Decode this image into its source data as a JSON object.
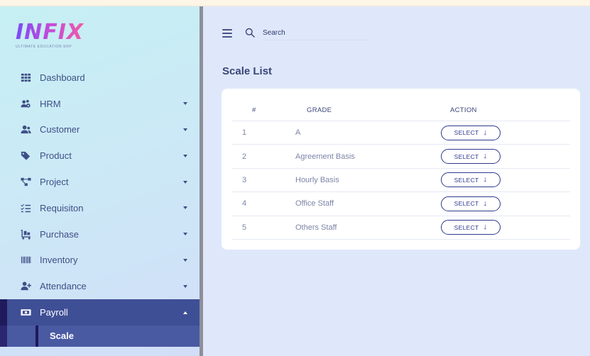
{
  "brand": {
    "name": "INFIX",
    "tagline": "ULTIMATE EDUCATION ERP"
  },
  "sidebar": {
    "items": [
      {
        "label": "Dashboard",
        "icon": "grid-icon",
        "expandable": false
      },
      {
        "label": "HRM",
        "icon": "users-gear-icon",
        "expandable": true
      },
      {
        "label": "Customer",
        "icon": "user-group-icon",
        "expandable": true
      },
      {
        "label": "Product",
        "icon": "tags-icon",
        "expandable": true
      },
      {
        "label": "Project",
        "icon": "project-diagram-icon",
        "expandable": true
      },
      {
        "label": "Requisiton",
        "icon": "checklist-icon",
        "expandable": true
      },
      {
        "label": "Purchase",
        "icon": "cart-flatbed-icon",
        "expandable": true
      },
      {
        "label": "Inventory",
        "icon": "barcode-icon",
        "expandable": true
      },
      {
        "label": "Attendance",
        "icon": "user-plus-icon",
        "expandable": true
      },
      {
        "label": "Payroll",
        "icon": "money-bill-icon",
        "expandable": true,
        "active": true
      }
    ],
    "subitems": [
      {
        "label": "Scale",
        "active": true
      }
    ]
  },
  "header": {
    "search_placeholder": "Search"
  },
  "page": {
    "title": "Scale List"
  },
  "table": {
    "columns": [
      "#",
      "GRADE",
      "ACTION"
    ],
    "rows": [
      {
        "num": "1",
        "grade": "A",
        "action": "SELECT"
      },
      {
        "num": "2",
        "grade": "Agreement Basis",
        "action": "SELECT"
      },
      {
        "num": "3",
        "grade": "Hourly Basis",
        "action": "SELECT"
      },
      {
        "num": "4",
        "grade": "Office Staff",
        "action": "SELECT"
      },
      {
        "num": "5",
        "grade": "Others Staff",
        "action": "SELECT"
      }
    ]
  },
  "colors": {
    "accent": "#3f4f96",
    "text": "#3f4f86",
    "button_border": "#2d3a8c"
  }
}
